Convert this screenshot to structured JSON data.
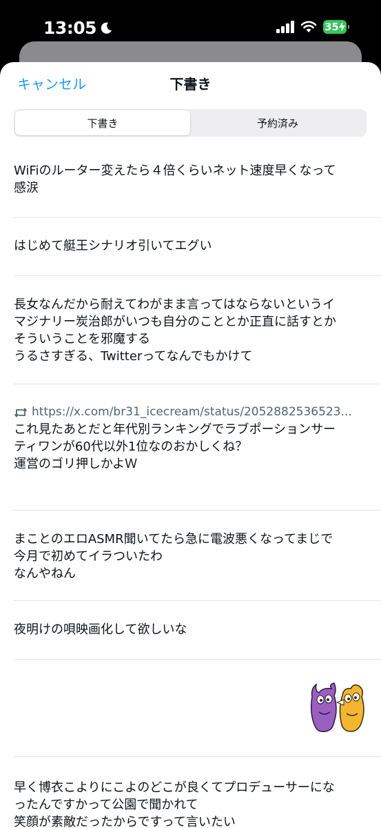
{
  "status_bar": {
    "time": "13:05",
    "battery": "35"
  },
  "header": {
    "cancel_label": "キャンセル",
    "title": "下書き"
  },
  "tabs": [
    {
      "label": "下書き",
      "active": true
    },
    {
      "label": "予約済み",
      "active": false
    }
  ],
  "drafts": [
    {
      "text": "WiFiのルーター変えたら４倍くらいネット速度早くなって\n感涙"
    },
    {
      "text": "はじめて艇王シナリオ引いてエグい"
    },
    {
      "text": "長女なんだから耐えてわがまま言ってはならないというイ\nマジナリー炭治郎がいつも自分のこととか正直に話すとか\nそういうことを邪魔する\nうるさすぎる、Twitterってなんでもかけて"
    },
    {
      "link": "https://x.com/br31_icecream/status/2052882536523...",
      "text": "これ見たあとだと年代別ランキングでラブポーションサー\nティワンが60代以外1位なのおかしくね？\n運営のゴリ押しかよＷ"
    },
    {
      "text": "まことのエロASMR聞いてたら急に電波悪くなってまじで\n今月で初めてイラついたわ\nなんやねん"
    },
    {
      "text": "夜明けの唄映画化して欲しいな"
    },
    {
      "text": ""
    },
    {
      "text": "早く博衣こよりにこよのどこが良くてプロデューサーにな\nったんですかって公園で聞かれて\n笑顔が素敵だったからですって言いたい"
    }
  ],
  "colors": {
    "accent": "#1d9bf0",
    "battery": "#34c759"
  }
}
